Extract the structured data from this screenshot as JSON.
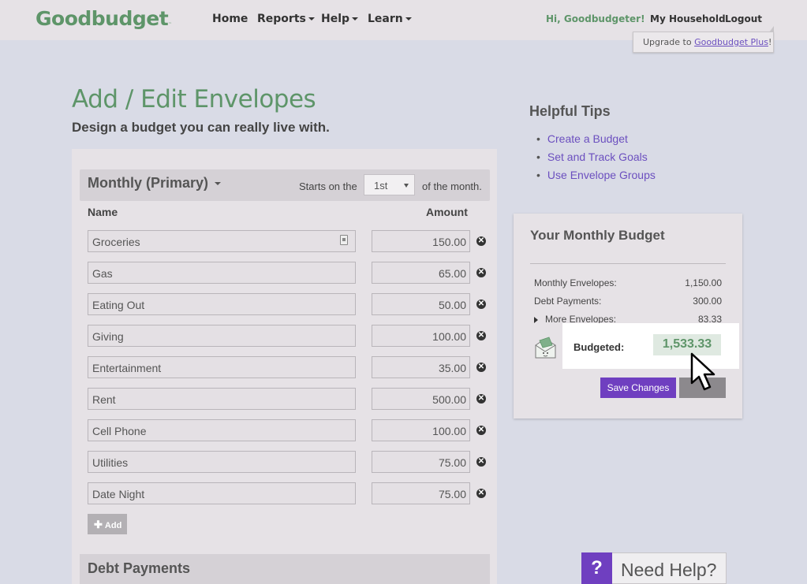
{
  "header": {
    "logo": "Goodbudget",
    "logo_tm": "™",
    "nav": [
      {
        "label": "Home",
        "dropdown": false
      },
      {
        "label": "Reports",
        "dropdown": true
      },
      {
        "label": "Help",
        "dropdown": true
      },
      {
        "label": "Learn",
        "dropdown": true
      }
    ],
    "greeting": "Hi, Goodbudgeter!",
    "household": "My Household",
    "logout": "Logout",
    "upgrade_prefix": "Upgrade to ",
    "upgrade_link": "Goodbudget Plus",
    "upgrade_suffix": "!"
  },
  "page": {
    "title": "Add / Edit Envelopes",
    "subtitle": "Design a budget you can really live with."
  },
  "envelopes_panel": {
    "period": "Monthly (Primary)",
    "starts_on": "Starts on the",
    "start_day": "1st",
    "of_month": "of the month.",
    "col_name": "Name",
    "col_amount": "Amount",
    "rows": [
      {
        "name": "Groceries",
        "amount": "150.00"
      },
      {
        "name": "Gas",
        "amount": "65.00"
      },
      {
        "name": "Eating Out",
        "amount": "50.00"
      },
      {
        "name": "Giving",
        "amount": "100.00"
      },
      {
        "name": "Entertainment",
        "amount": "35.00"
      },
      {
        "name": "Rent",
        "amount": "500.00"
      },
      {
        "name": "Cell Phone",
        "amount": "100.00"
      },
      {
        "name": "Utilities",
        "amount": "75.00"
      },
      {
        "name": "Date Night",
        "amount": "75.00"
      }
    ],
    "add_label": "Add",
    "debt_title": "Debt Payments"
  },
  "tips": {
    "title": "Helpful Tips",
    "items": [
      "Create a Budget",
      "Set and Track Goals",
      "Use Envelope Groups"
    ]
  },
  "budget": {
    "title": "Your Monthly Budget",
    "rows": [
      {
        "label": "Monthly Envelopes:",
        "value": "1,150.00"
      },
      {
        "label": "Debt Payments:",
        "value": "300.00"
      },
      {
        "label": "More Envelopes:",
        "value": "83.33"
      }
    ],
    "budgeted_label": "Budgeted:",
    "budgeted_value": "1,533.33",
    "save_label": "Save Changes"
  },
  "help_widget": {
    "icon": "?",
    "label": "Need Help?"
  },
  "colors": {
    "brand_green": "#5e9569",
    "accent_purple": "#6f3fc0",
    "link_purple": "#6b4fbf",
    "background": "#d9dbe6"
  }
}
